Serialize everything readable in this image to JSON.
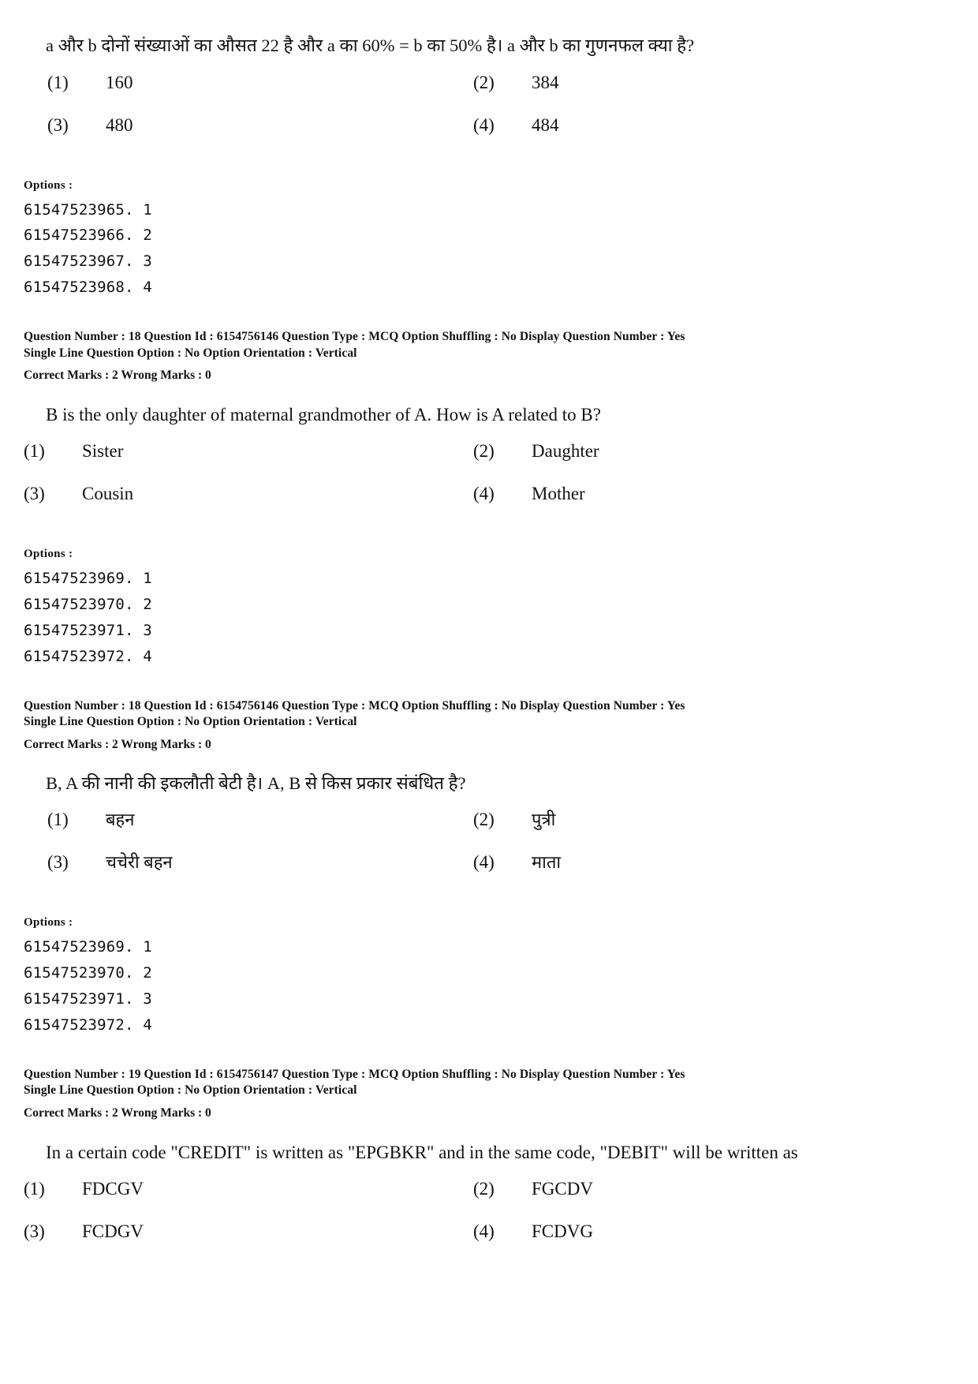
{
  "labels": {
    "options_heading": "Options :",
    "question_number_key": "Question Number :",
    "question_id_key": "Question Id :",
    "question_type_key": "Question Type :",
    "option_shuffling_key": "Option Shuffling :",
    "display_question_number_key": "Display Question Number :",
    "single_line_question_option_key": "Single Line Question Option :",
    "option_orientation_key": "Option Orientation :",
    "correct_marks_key": "Correct Marks :",
    "wrong_marks_key": "Wrong Marks :"
  },
  "blocks": {
    "q17_hindi": {
      "question_text": "a और b दोनों संख्याओं का औसत 22 है और a का 60% = b का 50% है। a और b का गुणनफल क्या है?",
      "choices": [
        {
          "num": "(1)",
          "value": "160"
        },
        {
          "num": "(2)",
          "value": "384"
        },
        {
          "num": "(3)",
          "value": "480"
        },
        {
          "num": "(4)",
          "value": "484"
        }
      ],
      "option_ids": [
        "61547523965. 1",
        "61547523966. 2",
        "61547523967. 3",
        "61547523968. 4"
      ]
    },
    "meta_18_english": {
      "line1": "Question Number : 18  Question Id : 6154756146  Question Type : MCQ  Option Shuffling : No  Display Question Number : Yes",
      "line2": "Single Line Question Option : No  Option Orientation : Vertical",
      "marks": "Correct Marks : 2  Wrong Marks : 0"
    },
    "q18_english": {
      "question_text": "B is the only daughter of maternal grandmother of A. How is A related to B?",
      "choices": [
        {
          "num": "(1)",
          "value": "Sister"
        },
        {
          "num": "(2)",
          "value": "Daughter"
        },
        {
          "num": "(3)",
          "value": "Cousin"
        },
        {
          "num": "(4)",
          "value": "Mother"
        }
      ],
      "option_ids": [
        "61547523969. 1",
        "61547523970. 2",
        "61547523971. 3",
        "61547523972. 4"
      ]
    },
    "meta_18_hindi": {
      "line1": "Question Number : 18  Question Id : 6154756146  Question Type : MCQ  Option Shuffling : No  Display Question Number : Yes",
      "line2": "Single Line Question Option : No  Option Orientation : Vertical",
      "marks": "Correct Marks : 2  Wrong Marks : 0"
    },
    "q18_hindi": {
      "question_text": "B, A की नानी की इकलौती बेटी है। A, B से किस प्रकार संबंधित है?",
      "choices": [
        {
          "num": "(1)",
          "value": "बहन"
        },
        {
          "num": "(2)",
          "value": "पुत्री"
        },
        {
          "num": "(3)",
          "value": "चचेरी बहन"
        },
        {
          "num": "(4)",
          "value": "माता"
        }
      ],
      "option_ids": [
        "61547523969. 1",
        "61547523970. 2",
        "61547523971. 3",
        "61547523972. 4"
      ]
    },
    "meta_19_english": {
      "line1": "Question Number : 19  Question Id : 6154756147  Question Type : MCQ  Option Shuffling : No  Display Question Number : Yes",
      "line2": "Single Line Question Option : No  Option Orientation : Vertical",
      "marks": "Correct Marks : 2  Wrong Marks : 0"
    },
    "q19_english": {
      "question_text": "In a certain code \"CREDIT\" is written as \"EPGBKR\" and in the same code, \"DEBIT\" will be written as",
      "choices": [
        {
          "num": "(1)",
          "value": "FDCGV"
        },
        {
          "num": "(2)",
          "value": "FGCDV"
        },
        {
          "num": "(3)",
          "value": "FCDGV"
        },
        {
          "num": "(4)",
          "value": "FCDVG"
        }
      ]
    }
  }
}
